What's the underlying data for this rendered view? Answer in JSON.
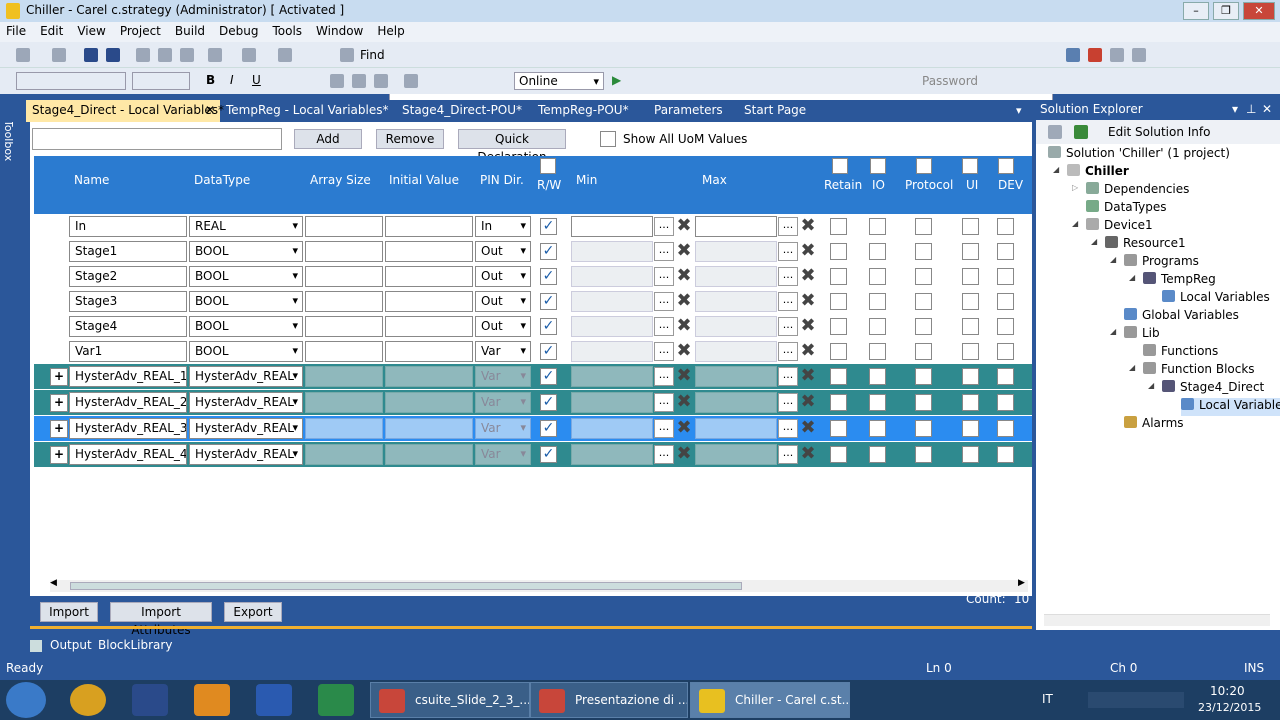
{
  "window": {
    "title": "Chiller - Carel c.strategy (Administrator) [ Activated ]"
  },
  "menu": [
    "File",
    "Edit",
    "View",
    "Project",
    "Build",
    "Debug",
    "Tools",
    "Window",
    "Help"
  ],
  "toolbar": {
    "find_label": "Find",
    "mode_value": "Online",
    "password_label": "Password"
  },
  "side_tab": "Toolbox",
  "doc_tabs": [
    {
      "label": "Stage4_Direct - Local Variables*",
      "active": true
    },
    {
      "label": "TempReg - Local Variables*"
    },
    {
      "label": "Stage4_Direct-POU*"
    },
    {
      "label": "TempReg-POU*"
    },
    {
      "label": "Parameters"
    },
    {
      "label": "Start Page"
    }
  ],
  "editor": {
    "add_label": "Add",
    "remove_label": "Remove",
    "quick_decl_label": "Quick Declaration",
    "show_uom_label": "Show All UoM Values",
    "columns": {
      "name": "Name",
      "datatype": "DataType",
      "array_size": "Array Size",
      "initial_value": "Initial Value",
      "pin_dir": "PIN Dir.",
      "rw": "R/W",
      "min": "Min",
      "max": "Max",
      "retain": "Retain",
      "io": "IO",
      "protocol": "Protocol",
      "ui": "UI",
      "dev": "DEV"
    },
    "rows": [
      {
        "name": "In",
        "datatype": "REAL",
        "pin": "In",
        "kind": "plain"
      },
      {
        "name": "Stage1",
        "datatype": "BOOL",
        "pin": "Out",
        "kind": "plain"
      },
      {
        "name": "Stage2",
        "datatype": "BOOL",
        "pin": "Out",
        "kind": "plain"
      },
      {
        "name": "Stage3",
        "datatype": "BOOL",
        "pin": "Out",
        "kind": "plain"
      },
      {
        "name": "Stage4",
        "datatype": "BOOL",
        "pin": "Out",
        "kind": "plain"
      },
      {
        "name": "Var1",
        "datatype": "BOOL",
        "pin": "Var",
        "kind": "plain"
      },
      {
        "name": "HysterAdv_REAL_1",
        "datatype": "HysterAdv_REAL",
        "pin": "Var",
        "kind": "fb"
      },
      {
        "name": "HysterAdv_REAL_2",
        "datatype": "HysterAdv_REAL",
        "pin": "Var",
        "kind": "fb"
      },
      {
        "name": "HysterAdv_REAL_3",
        "datatype": "HysterAdv_REAL",
        "pin": "Var",
        "kind": "sel"
      },
      {
        "name": "HysterAdv_REAL_4",
        "datatype": "HysterAdv_REAL",
        "pin": "Var",
        "kind": "fb"
      }
    ],
    "import_label": "Import",
    "import_attr_label": "Import Attributes",
    "export_label": "Export",
    "count_label": "Count:",
    "count_value": "10"
  },
  "solution": {
    "title": "Solution Explorer",
    "edit_info_label": "Edit Solution Info",
    "tree": [
      {
        "label": "Solution 'Chiller' (1 project)",
        "level": 0,
        "color": "#9aa"
      },
      {
        "label": "Chiller",
        "level": 1,
        "bold": true,
        "color": "#bbb"
      },
      {
        "label": "Dependencies",
        "level": 2,
        "color": "#8a9"
      },
      {
        "label": "DataTypes",
        "level": 2,
        "color": "#7a8"
      },
      {
        "label": "Device1",
        "level": 2,
        "color": "#aaa"
      },
      {
        "label": "Resource1",
        "level": 3,
        "color": "#666"
      },
      {
        "label": "Programs",
        "level": 4,
        "color": "#999"
      },
      {
        "label": "TempReg",
        "level": 5,
        "color": "#557"
      },
      {
        "label": "Local Variables",
        "level": 6,
        "color": "#5a8ac8"
      },
      {
        "label": "Global Variables",
        "level": 4,
        "color": "#5a8ac8"
      },
      {
        "label": "Lib",
        "level": 4,
        "color": "#999"
      },
      {
        "label": "Functions",
        "level": 5,
        "color": "#999"
      },
      {
        "label": "Function Blocks",
        "level": 5,
        "color": "#999"
      },
      {
        "label": "Stage4_Direct",
        "level": 6,
        "color": "#557"
      },
      {
        "label": "Local Variables",
        "level": 7,
        "color": "#5a8ac8",
        "selected": true
      },
      {
        "label": "Alarms",
        "level": 4,
        "color": "#c9a040"
      }
    ]
  },
  "output_tabs": [
    "Output",
    "BlockLibrary"
  ],
  "status": {
    "ready": "Ready",
    "ln": "Ln 0",
    "ch": "Ch 0",
    "ins": "INS"
  },
  "taskbar": {
    "items": [
      "csuite_Slide_2_3_...",
      "Presentazione di ...",
      "Chiller - Carel c.st..."
    ],
    "lang": "IT",
    "time": "10:20",
    "date": "23/12/2015"
  }
}
